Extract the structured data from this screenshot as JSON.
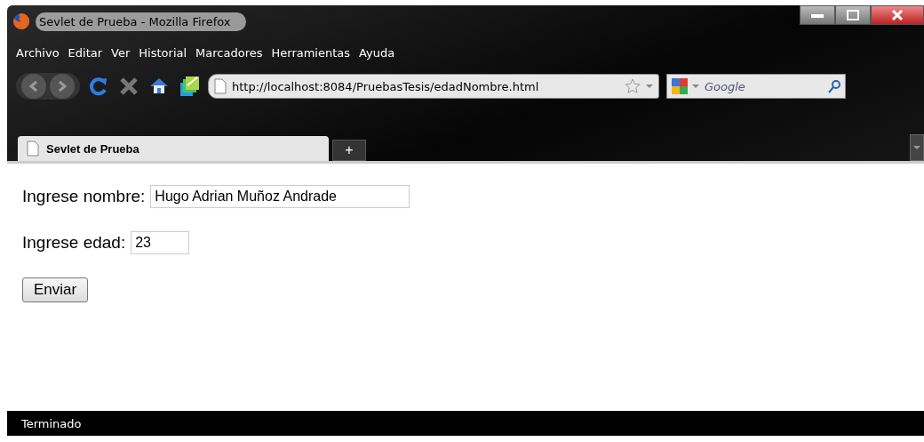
{
  "window": {
    "title": "Sevlet de Prueba - Mozilla Firefox"
  },
  "menu": [
    "Archivo",
    "Editar",
    "Ver",
    "Historial",
    "Marcadores",
    "Herramientas",
    "Ayuda"
  ],
  "address_bar": {
    "value": "http://localhost:8084/PruebasTesis/edadNombre.html"
  },
  "search": {
    "placeholder": "Google"
  },
  "tabs": [
    {
      "label": "Sevlet de Prueba",
      "selected": true
    }
  ],
  "new_tab": "+",
  "form": {
    "fields": [
      {
        "label": "Ingrese nombre:",
        "value": "Hugo Adrian Muñoz Andrade",
        "kind": "wide"
      },
      {
        "label": "Ingrese edad:",
        "value": "23",
        "kind": "narrow"
      }
    ],
    "button": "Enviar"
  },
  "status_bar": "Terminado"
}
